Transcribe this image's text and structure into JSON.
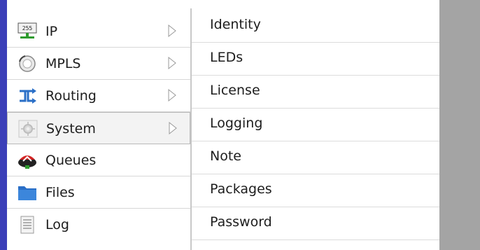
{
  "left_menu": {
    "items": [
      {
        "label": "IP",
        "icon": "ip-icon",
        "has_submenu": true
      },
      {
        "label": "MPLS",
        "icon": "mpls-icon",
        "has_submenu": true
      },
      {
        "label": "Routing",
        "icon": "routing-icon",
        "has_submenu": true
      },
      {
        "label": "System",
        "icon": "system-gear-icon",
        "has_submenu": true,
        "active": true
      },
      {
        "label": "Queues",
        "icon": "queues-icon",
        "has_submenu": false
      },
      {
        "label": "Files",
        "icon": "folder-icon",
        "has_submenu": false
      },
      {
        "label": "Log",
        "icon": "log-document-icon",
        "has_submenu": false
      }
    ]
  },
  "submenu": {
    "items": [
      {
        "label": "Identity"
      },
      {
        "label": "LEDs"
      },
      {
        "label": "License"
      },
      {
        "label": "Logging"
      },
      {
        "label": "Note"
      },
      {
        "label": "Packages"
      },
      {
        "label": "Password"
      }
    ]
  },
  "colors": {
    "blue_band": "#3b3fb8",
    "menu_bg": "#ffffff",
    "active_bg": "#f3f3f3",
    "right_gray": "#a4a4a4"
  }
}
